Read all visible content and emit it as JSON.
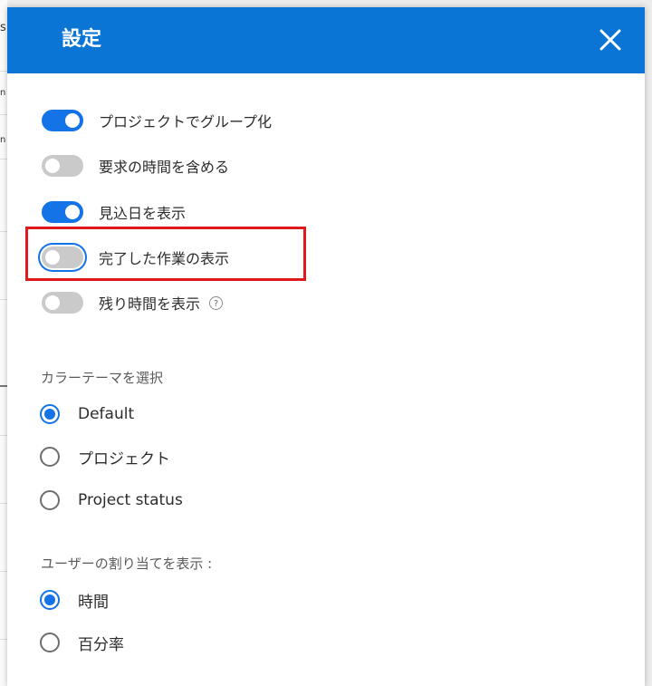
{
  "background": {
    "fragments": [
      "s",
      "n",
      "n"
    ]
  },
  "header": {
    "title": "設定",
    "close_icon": "close-icon",
    "color": "#0a75d4"
  },
  "toggles": [
    {
      "label": "プロジェクトでグループ化",
      "on": true
    },
    {
      "label": "要求の時間を含める",
      "on": false
    },
    {
      "label": "見込日を表示",
      "on": true
    },
    {
      "label": "完了した作業の表示",
      "on": false,
      "highlighted": true
    },
    {
      "label": "残り時間を表示",
      "on": false,
      "help": "?"
    }
  ],
  "color_theme": {
    "title": "カラーテーマを選択",
    "options": [
      "Default",
      "プロジェクト",
      "Project status"
    ],
    "selected": "Default"
  },
  "assignment_display": {
    "title": "ユーザーの割り当てを表示 :",
    "options": [
      "時間",
      "百分率"
    ],
    "selected": "時間"
  },
  "colors": {
    "accent": "#1473e6",
    "highlight_box": "#e0191e"
  }
}
